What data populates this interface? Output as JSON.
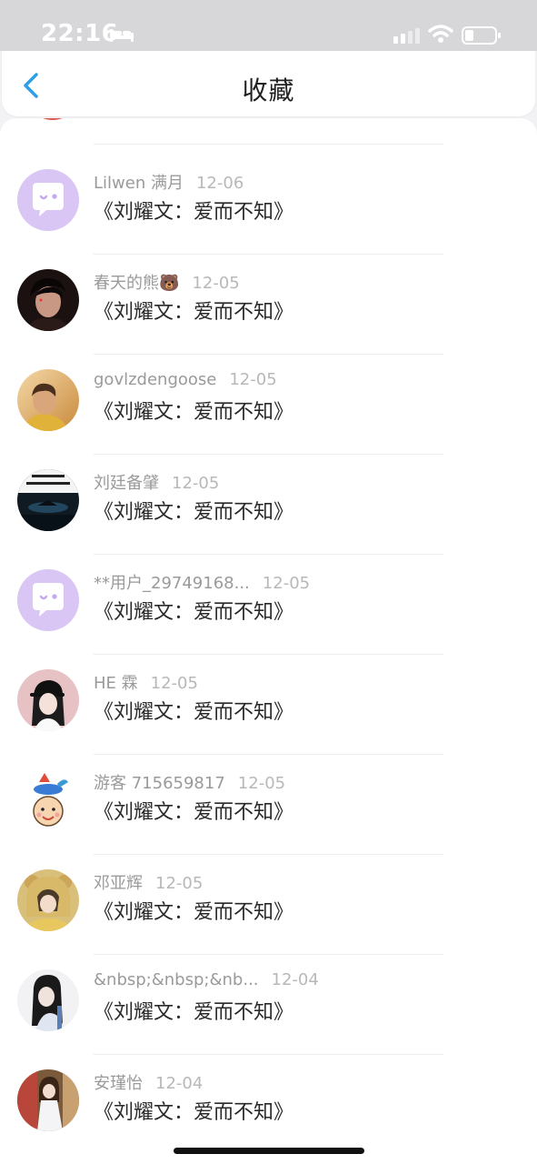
{
  "status_bar": {
    "time": "22:16"
  },
  "header": {
    "title": "收藏"
  },
  "items": [
    {
      "author": "Lilwen 满月",
      "date": "12-06",
      "title": "《刘耀文：爱而不知》",
      "avatar": "default-chat-avatar"
    },
    {
      "author": "春天的熊🐻",
      "date": "12-05",
      "title": "《刘耀文：爱而不知》",
      "avatar": "boy-portrait-avatar"
    },
    {
      "author": "govlzdengoose",
      "date": "12-05",
      "title": "《刘耀文：爱而不知》",
      "avatar": "sunset-portrait-avatar"
    },
    {
      "author": "刘廷备肈",
      "date": "12-05",
      "title": "《刘耀文：爱而不知》",
      "avatar": "night-island-avatar"
    },
    {
      "author": "**用户_29749168...",
      "date": "12-05",
      "title": "《刘耀文：爱而不知》",
      "avatar": "default-chat-avatar"
    },
    {
      "author": "HE 霖",
      "date": "12-05",
      "title": "《刘耀文：爱而不知》",
      "avatar": "cap-girl-avatar"
    },
    {
      "author": "游客 715659817",
      "date": "12-05",
      "title": "《刘耀文：爱而不知》",
      "avatar": "cartoon-guest-avatar"
    },
    {
      "author": "邓亚辉",
      "date": "12-05",
      "title": "《刘耀文：爱而不知》",
      "avatar": "bear-hat-girl-avatar"
    },
    {
      "author": "&nbsp;&nbsp;&nb...",
      "date": "12-04",
      "title": "《刘耀文：爱而不知》",
      "avatar": "long-hair-girl-avatar"
    },
    {
      "author": "安瑾怡",
      "date": "12-04",
      "title": "《刘耀文：爱而不知》",
      "avatar": "dress-girl-avatar"
    }
  ],
  "colors": {
    "accent": "#2f9ee8",
    "default_avatar_bg": "#d9c6f5",
    "status_bar_bg": "#d7d7d9"
  }
}
